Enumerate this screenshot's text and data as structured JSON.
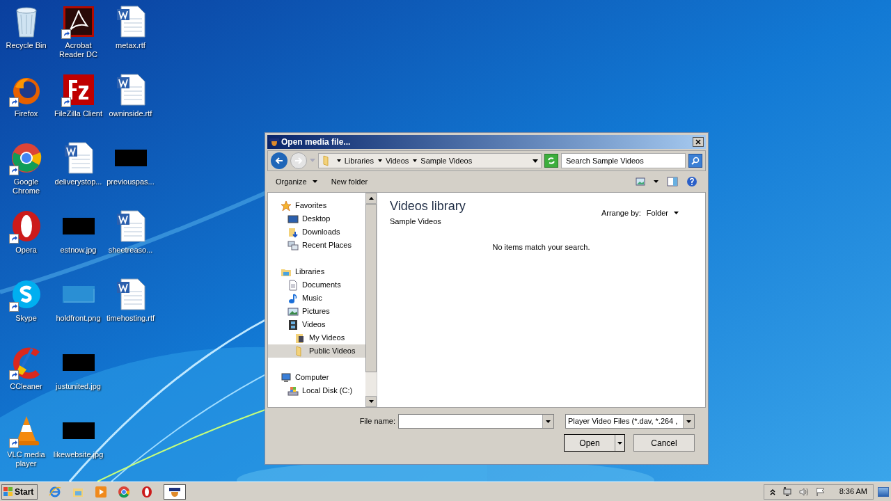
{
  "desktop_columns": [
    [
      {
        "label": "Recycle Bin",
        "kind": "recycle",
        "shortcut": false
      },
      {
        "label": "Firefox",
        "kind": "firefox",
        "shortcut": true
      },
      {
        "label": "Google Chrome",
        "kind": "chrome",
        "shortcut": true
      },
      {
        "label": "Opera",
        "kind": "opera",
        "shortcut": true
      },
      {
        "label": "Skype",
        "kind": "skype",
        "shortcut": true
      },
      {
        "label": "CCleaner",
        "kind": "ccleaner",
        "shortcut": true
      },
      {
        "label": "VLC media player",
        "kind": "vlc",
        "shortcut": true
      }
    ],
    [
      {
        "label": "Acrobat Reader DC",
        "kind": "acrobat",
        "shortcut": true
      },
      {
        "label": "FileZilla Client",
        "kind": "filezilla",
        "shortcut": true
      },
      {
        "label": "deliverystop...",
        "kind": "word",
        "shortcut": false
      },
      {
        "label": "estnow.jpg",
        "kind": "redacted",
        "shortcut": false
      },
      {
        "label": "holdfront.png",
        "kind": "thumbnail",
        "shortcut": false
      },
      {
        "label": "justunited.jpg",
        "kind": "redacted",
        "shortcut": false
      },
      {
        "label": "likewebsite.jpg",
        "kind": "redacted",
        "shortcut": false
      }
    ],
    [
      {
        "label": "metax.rtf",
        "kind": "word",
        "shortcut": false
      },
      {
        "label": "owninside.rtf",
        "kind": "word",
        "shortcut": false
      },
      {
        "label": "previouspas...",
        "kind": "redacted",
        "shortcut": false
      },
      {
        "label": "sheetreaso...",
        "kind": "word",
        "shortcut": false
      },
      {
        "label": "timehosting.rtf",
        "kind": "word",
        "shortcut": false
      }
    ]
  ],
  "dialog": {
    "title": "Open media file...",
    "breadcrumb": [
      "Libraries",
      "Videos",
      "Sample Videos"
    ],
    "search": {
      "placeholder": "Search Sample Videos"
    },
    "toolbar": [
      {
        "label": "Organize",
        "dropdown": true
      },
      {
        "label": "New folder",
        "dropdown": false
      }
    ],
    "nav": [
      {
        "label": "Favorites",
        "kind": "star",
        "selected": false,
        "children": [
          {
            "label": "Desktop",
            "kind": "desktop",
            "selected": false
          },
          {
            "label": "Downloads",
            "kind": "downloads",
            "selected": false
          },
          {
            "label": "Recent Places",
            "kind": "recent",
            "selected": false
          }
        ]
      },
      {
        "label": "Libraries",
        "kind": "library",
        "selected": false,
        "children": [
          {
            "label": "Documents",
            "kind": "document",
            "selected": false
          },
          {
            "label": "Music",
            "kind": "music",
            "selected": false
          },
          {
            "label": "Pictures",
            "kind": "pictures",
            "selected": false
          },
          {
            "label": "Videos",
            "kind": "videos",
            "selected": false,
            "children": [
              {
                "label": "My Videos",
                "kind": "videofolder",
                "selected": false
              },
              {
                "label": "Public Videos",
                "kind": "folder",
                "selected": true
              }
            ]
          }
        ]
      },
      {
        "label": "Computer",
        "kind": "computer",
        "selected": false,
        "children": [
          {
            "label": "Local Disk (C:)",
            "kind": "disk",
            "selected": false
          }
        ]
      }
    ],
    "content": {
      "heading": "Videos library",
      "subtitle": "Sample Videos",
      "arrange_label": "Arrange by:",
      "arrange_value": "Folder",
      "empty_message": "No items match your search."
    },
    "file_name_label": "File name:",
    "file_type": "Player Video Files (*.dav, *.264 ,",
    "buttons": [
      {
        "label": "Open",
        "split": true
      },
      {
        "label": "Cancel",
        "split": false
      }
    ]
  },
  "taskbar": {
    "start": "Start",
    "items": [
      {
        "kind": "ie",
        "selected": false
      },
      {
        "kind": "explorer",
        "selected": false
      },
      {
        "kind": "media",
        "selected": false
      },
      {
        "kind": "chrome",
        "selected": false
      },
      {
        "kind": "opera",
        "selected": false
      },
      {
        "kind": "player",
        "selected": true
      }
    ],
    "clock": "8:36 AM"
  }
}
